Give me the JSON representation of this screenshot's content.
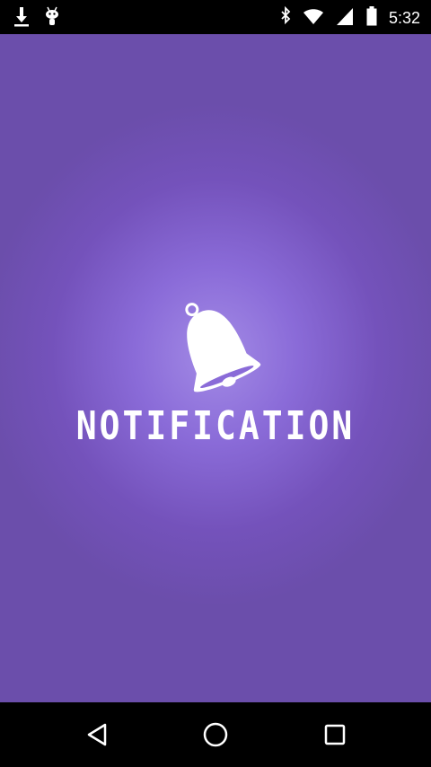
{
  "status_bar": {
    "time": "5:32",
    "icons_left": [
      "download-icon",
      "android-icon"
    ],
    "icons_right": [
      "bluetooth-icon",
      "wifi-icon",
      "signal-icon",
      "battery-icon"
    ]
  },
  "splash": {
    "logo_text": "NOTIFICATION",
    "logo_icon": "bell-icon",
    "colors": {
      "background": "#6b4eab",
      "glow": "#a38be6",
      "logo": "#ffffff"
    }
  },
  "nav_bar": {
    "buttons": [
      "back-icon",
      "home-icon",
      "recents-icon"
    ]
  }
}
